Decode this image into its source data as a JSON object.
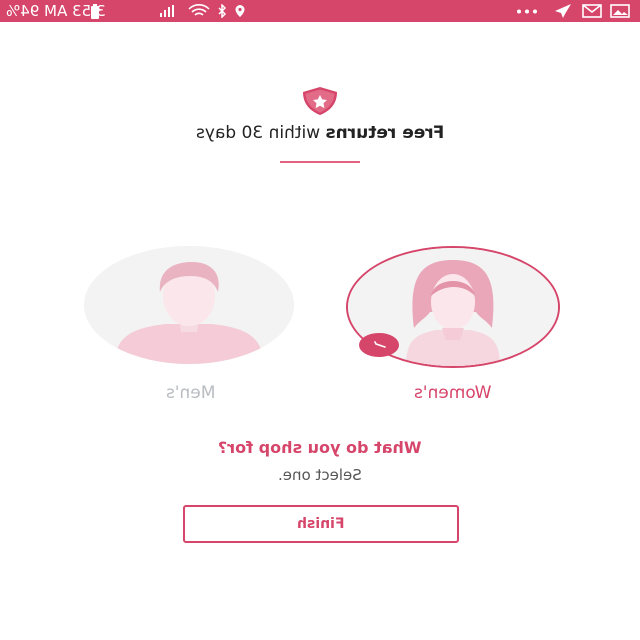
{
  "status_bar": {
    "time_battery": "3:53 AM  94%",
    "colors": {
      "background": "#d6456a",
      "foreground": "#ffffff"
    },
    "icons_left": [
      "location-icon",
      "bluetooth-icon",
      "wifi-icon",
      "signal-icon",
      "battery-icon"
    ],
    "icons_right": [
      "more-dots-icon",
      "send-icon",
      "gmail-icon",
      "image-icon"
    ]
  },
  "header": {
    "badge_icon": "shield-star-icon",
    "headline_bold": "Free returns",
    "headline_rest": " within 30 days"
  },
  "options": [
    {
      "label": "Women's",
      "selected": true,
      "avatar_icon": "woman-avatar-icon"
    },
    {
      "label": "Men's",
      "selected": false,
      "avatar_icon": "man-avatar-icon"
    }
  ],
  "question": "What do you shop for?",
  "subtitle": "Select one.",
  "finish_label": "Finish",
  "theme": {
    "accent": "#d6456a",
    "muted": "#b8bcc0"
  }
}
